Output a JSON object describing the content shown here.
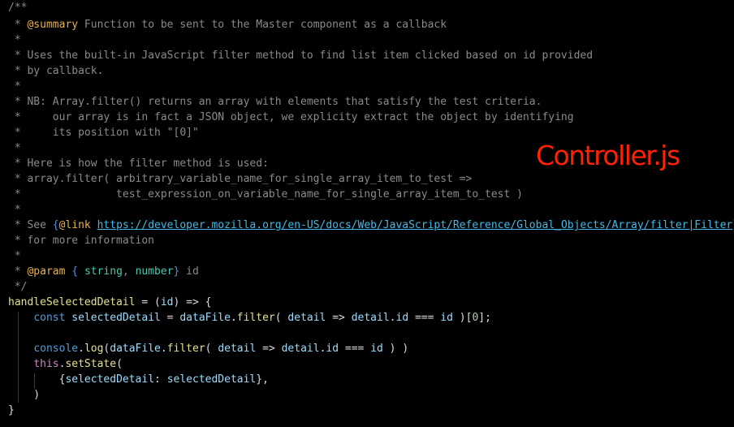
{
  "file_label": "Controller.js",
  "code_lines": [
    "/**",
    " * @summary Function to be sent to the Master component as a callback",
    " *",
    " * Uses the built-in JavaScript filter method to find list item clicked based on id provided",
    " * by callback.",
    " *",
    " * NB: Array.filter() returns an array with elements that satisfy the test criteria.",
    " *     our array is in fact a JSON object, we explicity extract the object by identifying",
    " *     its position with \"[0]\"",
    " *",
    " * Here is how the filter method is used:",
    " * array.filter( arbitrary_variable_name_for_single_array_item_to_test =>",
    " *               test_expression_on_variable_name_for_single_array_item_to_test )",
    " *",
    " * See {@link https://developer.mozilla.org/en-US/docs/Web/JavaScript/Reference/Global_Objects/Array/filter|Filter}",
    " * for more information",
    " *",
    " * @param { string, number} id",
    " */",
    "handleSelectedDetail = (id) => {",
    "    const selectedDetail = dataFile.filter( detail => detail.id === id )[0];",
    "",
    "    console.log(dataFile.filter( detail => detail.id === id ) )",
    "    this.setState(",
    "        {selectedDetail: selectedDetail},",
    "    )",
    "}"
  ],
  "colors": {
    "background": "#000000",
    "comment": "#8a8a8a",
    "jsdoc_tag": "#e8b04a",
    "jsdoc_type": "#45c9b0",
    "link": "#44b8e6",
    "function": "#e3e08f",
    "keyword": "#569cd6",
    "this_keyword": "#c586c0",
    "label": "#ff2200"
  }
}
